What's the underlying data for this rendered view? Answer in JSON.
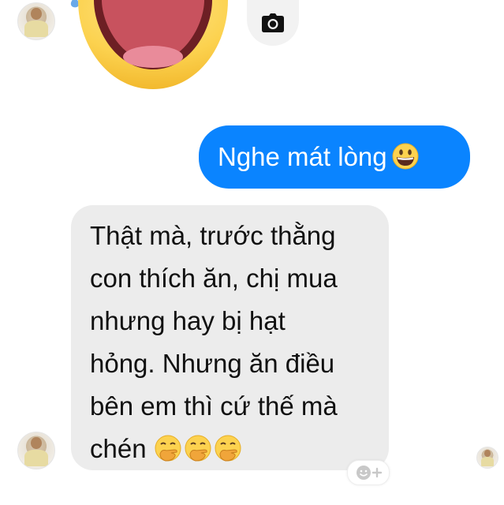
{
  "conversation": {
    "messages": [
      {
        "direction": "outgoing",
        "text": "Nghe mát lòng",
        "emoji": "grinning-face"
      },
      {
        "direction": "incoming",
        "lines": [
          "Thật mà, trước thằng",
          "con thích ăn, chị mua",
          "nhưng hay bị hạt",
          "hỏng. Nhưng ăn điều",
          "bên em thì cứ thế mà",
          "chén"
        ],
        "trailing_emojis": [
          "face-with-hand-over-mouth",
          "face-with-hand-over-mouth",
          "face-with-hand-over-mouth"
        ]
      }
    ]
  },
  "toolbar": {
    "camera_icon": "camera-icon"
  },
  "reaction": {
    "icon": "add-reaction-icon"
  },
  "colors": {
    "outgoing_bubble": "#0a84ff",
    "incoming_bubble": "#ececec",
    "outgoing_text": "#ffffff",
    "incoming_text": "#111111"
  }
}
